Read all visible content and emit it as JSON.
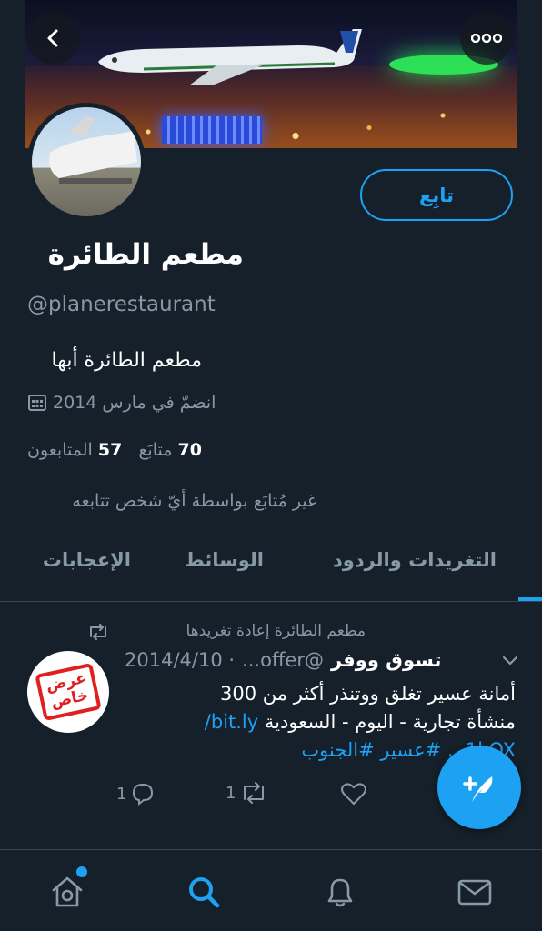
{
  "header": {
    "back_icon": "chevron-left-icon",
    "more_icon": "ellipsis-icon"
  },
  "profile": {
    "follow_label": "تابِع",
    "name": "مطعم الطائرة",
    "handle": "@planerestaurant",
    "bio": "مطعم الطائرة أبها",
    "joined": "انضمّ في مارس 2014",
    "following_count": "70",
    "following_label": "متابَع",
    "followers_count": "57",
    "followers_label": "المتابعون",
    "not_followed_text": "غير مُتابَع بواسطة أيّ شخص تتابعه"
  },
  "tabs": [
    {
      "label": "التغريدات والردود"
    },
    {
      "label": "الوسائط"
    },
    {
      "label": "الإعجابات"
    }
  ],
  "tweet": {
    "retweeted_by": "مطعم الطائرة إعادة تغريدها",
    "author_name": "تسوق ووفر",
    "author_handle": "@offer...",
    "date": "· 2014/4/10",
    "avatar_text_line1": "عرض",
    "avatar_text_line2": "خاص",
    "body_line1": "أمانة عسير تغلق ووتنذر أكثر من 300",
    "body_line2_text": "منشأة تجارية - اليوم - السعودية ",
    "body_line2_link": "bit.ly/",
    "body_line3_link": "1kOX... #عسير #الجنوب",
    "reply_count": "1",
    "retweet_count": "1"
  },
  "colors": {
    "background": "#15202b",
    "accent": "#1da1f2",
    "secondary_text": "#8899a6",
    "border": "#38444d"
  },
  "nav": [
    {
      "icon": "home-icon"
    },
    {
      "icon": "search-icon"
    },
    {
      "icon": "bell-icon"
    },
    {
      "icon": "mail-icon"
    }
  ]
}
